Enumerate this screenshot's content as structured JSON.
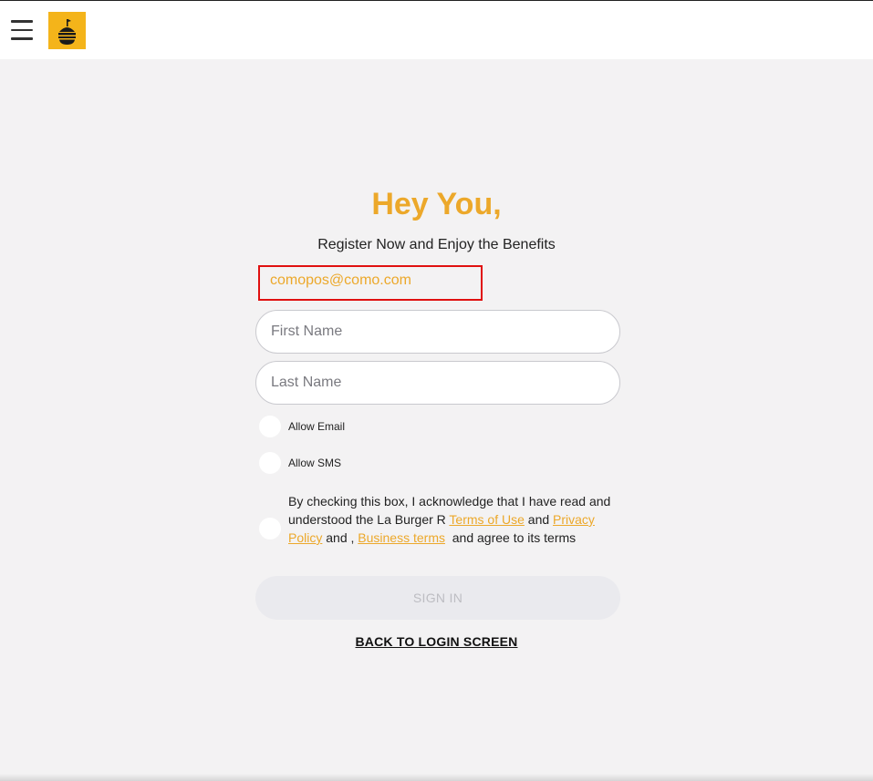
{
  "header": {
    "menu_icon": "hamburger-menu-icon",
    "logo_icon": "la-burger-logo",
    "logo_color": "#f4b41a"
  },
  "form": {
    "heading": "Hey You,",
    "subheading": "Register Now and Enjoy the Benefits",
    "email_value": "comopos@como.com",
    "first_name": {
      "value": "",
      "placeholder": "First Name"
    },
    "last_name": {
      "value": "",
      "placeholder": "Last Name"
    },
    "allow_email_label": "Allow Email",
    "allow_sms_label": "Allow SMS",
    "terms": {
      "part1": "By checking this box, I acknowledge that I have read and understood the La Burger R ",
      "terms_link": "Terms of Use",
      "part2": " and ",
      "privacy_link": "Privacy Policy",
      "part3": " and , ",
      "business_link": "Business terms",
      "part4": "  and agree to its terms"
    },
    "signin_label": "SIGN IN",
    "back_label": "BACK TO LOGIN SCREEN"
  },
  "colors": {
    "accent": "#eca82a",
    "highlight_border": "#e01010",
    "background": "#f3f2f3"
  }
}
